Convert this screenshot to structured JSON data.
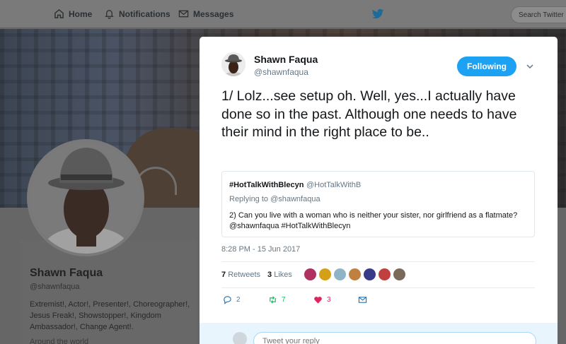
{
  "nav": {
    "home": "Home",
    "notifications": "Notifications",
    "messages": "Messages",
    "search_placeholder": "Search Twitter"
  },
  "profile": {
    "name": "Shawn Faqua",
    "handle": "@shawnfaqua",
    "bio": "Extremist!, Actor!, Presenter!, Choreographer!, Jesus Freak!, Showstopper!, Kingdom Ambassador!, Change Agent!.",
    "location": "Around the world"
  },
  "tweet": {
    "author_name": "Shawn Faqua",
    "author_handle": "@shawnfaqua",
    "follow_label": "Following",
    "text": "1/ Lolz...see setup oh. Well, yes...I actually have done so in the past. Although one needs to have their mind in the right place to be..",
    "quote": {
      "name": "#HotTalkWithBlecyn",
      "handle": "@HotTalkWithB",
      "replying_to": "Replying to @shawnfaqua",
      "text": "2) Can you live with a woman who is neither your sister, nor girlfriend as a flatmate? @shawnfaqua  #HotTalkWithBlecyn"
    },
    "timestamp": "8:28 PM - 15 Jun 2017",
    "retweets_count": "7",
    "retweets_label": "Retweets",
    "likes_count": "3",
    "likes_label": "Likes",
    "likers": [
      "#b03060",
      "#d4a017",
      "#8fb4c8",
      "#c08040",
      "#3a3a8a",
      "#c04040",
      "#7a6a5a"
    ],
    "actions": {
      "reply_count": "2",
      "retweet_count": "7",
      "like_count": "3"
    },
    "reply_placeholder": "Tweet your reply"
  },
  "colors": {
    "accent": "#1da1f2",
    "like": "#e0245e",
    "retweet": "#17bf63"
  }
}
